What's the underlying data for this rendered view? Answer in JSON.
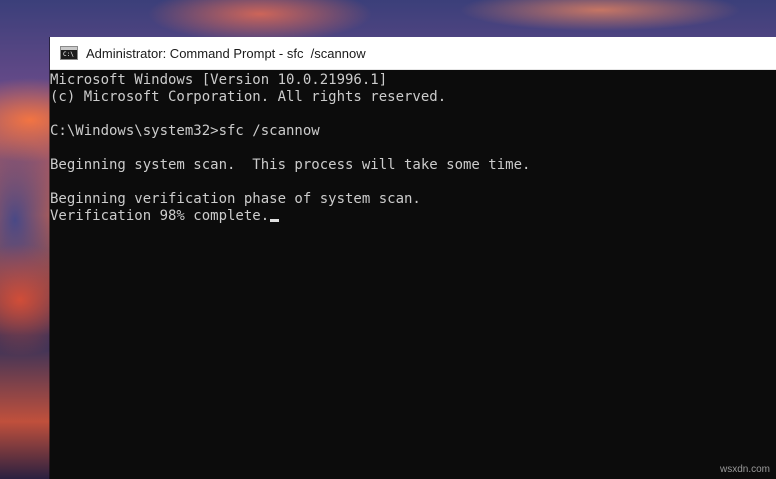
{
  "window": {
    "title": "Administrator: Command Prompt - sfc  /scannow",
    "icon": "cmd-icon",
    "icon_glyph": "C:\\"
  },
  "console": {
    "lines": [
      "Microsoft Windows [Version 10.0.21996.1]",
      "(c) Microsoft Corporation. All rights reserved.",
      "",
      "C:\\Windows\\system32>sfc /scannow",
      "",
      "Beginning system scan.  This process will take some time.",
      "",
      "Beginning verification phase of system scan.",
      "Verification 98% complete."
    ],
    "text_color": "#cccccc",
    "background_color": "#0c0c0c"
  },
  "watermark": "wsxdn.com"
}
